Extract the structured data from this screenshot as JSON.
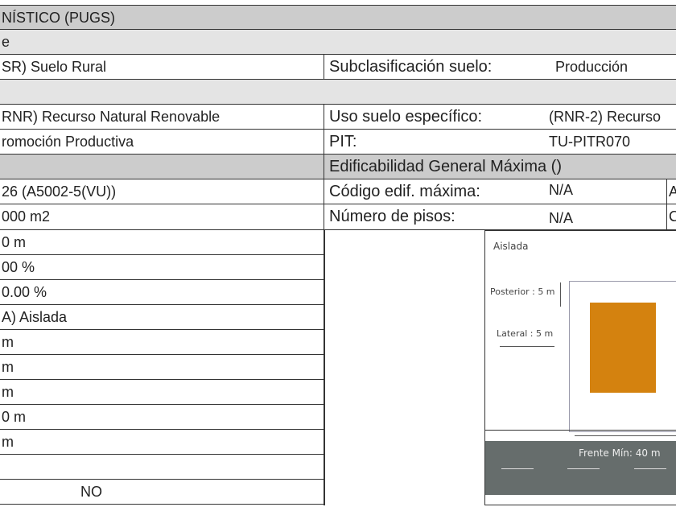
{
  "section_title": "NÍSTICO (PUGS)",
  "subsection_1": "e",
  "clasificacion_value": "SR) Suelo Rural",
  "subclasificacion": {
    "label": "Subclasificación suelo:",
    "value": "Producción"
  },
  "uso_general_value": "RNR) Recurso Natural Renovable",
  "uso_especifico": {
    "label": "Uso suelo específico:",
    "value": "(RNR-2) Recurso"
  },
  "tratamiento_value": "romoción Productiva",
  "pit": {
    "label": "PIT:",
    "value": "TU-PITR070"
  },
  "edificabilidad_title": "Edificabilidad General Máxima ()",
  "codigo_value": "26 (A5002-5(VU))",
  "codigo_edif": {
    "label": "Código edif. máxima:",
    "value": "N/A",
    "extra": "A"
  },
  "lote_min": "000 m2",
  "num_pisos": {
    "label": "Número de pisos:",
    "value": "N/A",
    "extra": "C"
  },
  "left_values": [
    "0 m",
    "00 %",
    "0.00 %",
    "A) Aislada",
    "m",
    "m",
    "m",
    "0 m",
    "m",
    "",
    "NO"
  ],
  "diagram": {
    "title": "Aislada",
    "posterior": "Posterior : 5 m",
    "lateral": "Lateral : 5 m",
    "frente": "Frente Mín: 40 m",
    "building_color": "#d4820f",
    "road_color": "#666d6c"
  }
}
